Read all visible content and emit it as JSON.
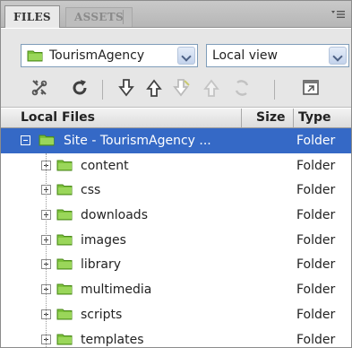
{
  "tabs": [
    {
      "label": "FILES",
      "active": true
    },
    {
      "label": "ASSETS",
      "active": false
    }
  ],
  "site_selector": {
    "value": "TourismAgency"
  },
  "view_selector": {
    "value": "Local view"
  },
  "toolbar": {
    "buttons": [
      {
        "name": "connect-icon",
        "enabled": true
      },
      {
        "name": "refresh-icon",
        "enabled": true
      },
      {
        "name": "get-files-icon",
        "enabled": true
      },
      {
        "name": "put-files-icon",
        "enabled": true
      },
      {
        "name": "check-out-icon",
        "enabled": false
      },
      {
        "name": "check-in-icon",
        "enabled": false
      },
      {
        "name": "sync-icon",
        "enabled": false
      },
      {
        "name": "expand-panel-icon",
        "enabled": true
      }
    ]
  },
  "columns": {
    "name": "Local Files",
    "size": "Size",
    "type": "Type"
  },
  "root": {
    "name": "Site - TourismAgency ...",
    "type": "Folder"
  },
  "folders": [
    {
      "name": "content",
      "type": "Folder"
    },
    {
      "name": "css",
      "type": "Folder"
    },
    {
      "name": "downloads",
      "type": "Folder"
    },
    {
      "name": "images",
      "type": "Folder"
    },
    {
      "name": "library",
      "type": "Folder"
    },
    {
      "name": "multimedia",
      "type": "Folder"
    },
    {
      "name": "scripts",
      "type": "Folder"
    },
    {
      "name": "templates",
      "type": "Folder"
    }
  ],
  "colors": {
    "selection": "#3569c6",
    "folder": "#7cc13a"
  }
}
